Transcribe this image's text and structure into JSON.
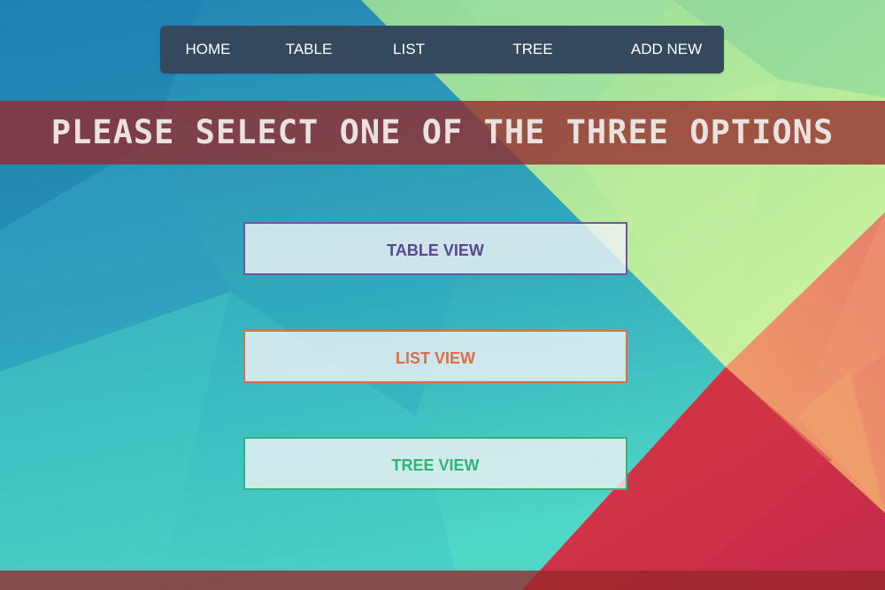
{
  "nav": {
    "items": [
      {
        "label": "HOME"
      },
      {
        "label": "TABLE"
      },
      {
        "label": "LIST"
      },
      {
        "label": "TREE"
      },
      {
        "label": "ADD NEW"
      }
    ]
  },
  "banner": {
    "text": "PLEASE SELECT ONE OF THE THREE OPTIONS"
  },
  "options": {
    "table": {
      "label": "TABLE VIEW"
    },
    "list": {
      "label": "LIST VIEW"
    },
    "tree": {
      "label": "TREE VIEW"
    }
  },
  "colors": {
    "nav_bg": "#34495e",
    "banner_bg": "#96282a",
    "table_accent": "#6f54a8",
    "list_accent": "#dd6e48",
    "tree_accent": "#2fb577"
  }
}
